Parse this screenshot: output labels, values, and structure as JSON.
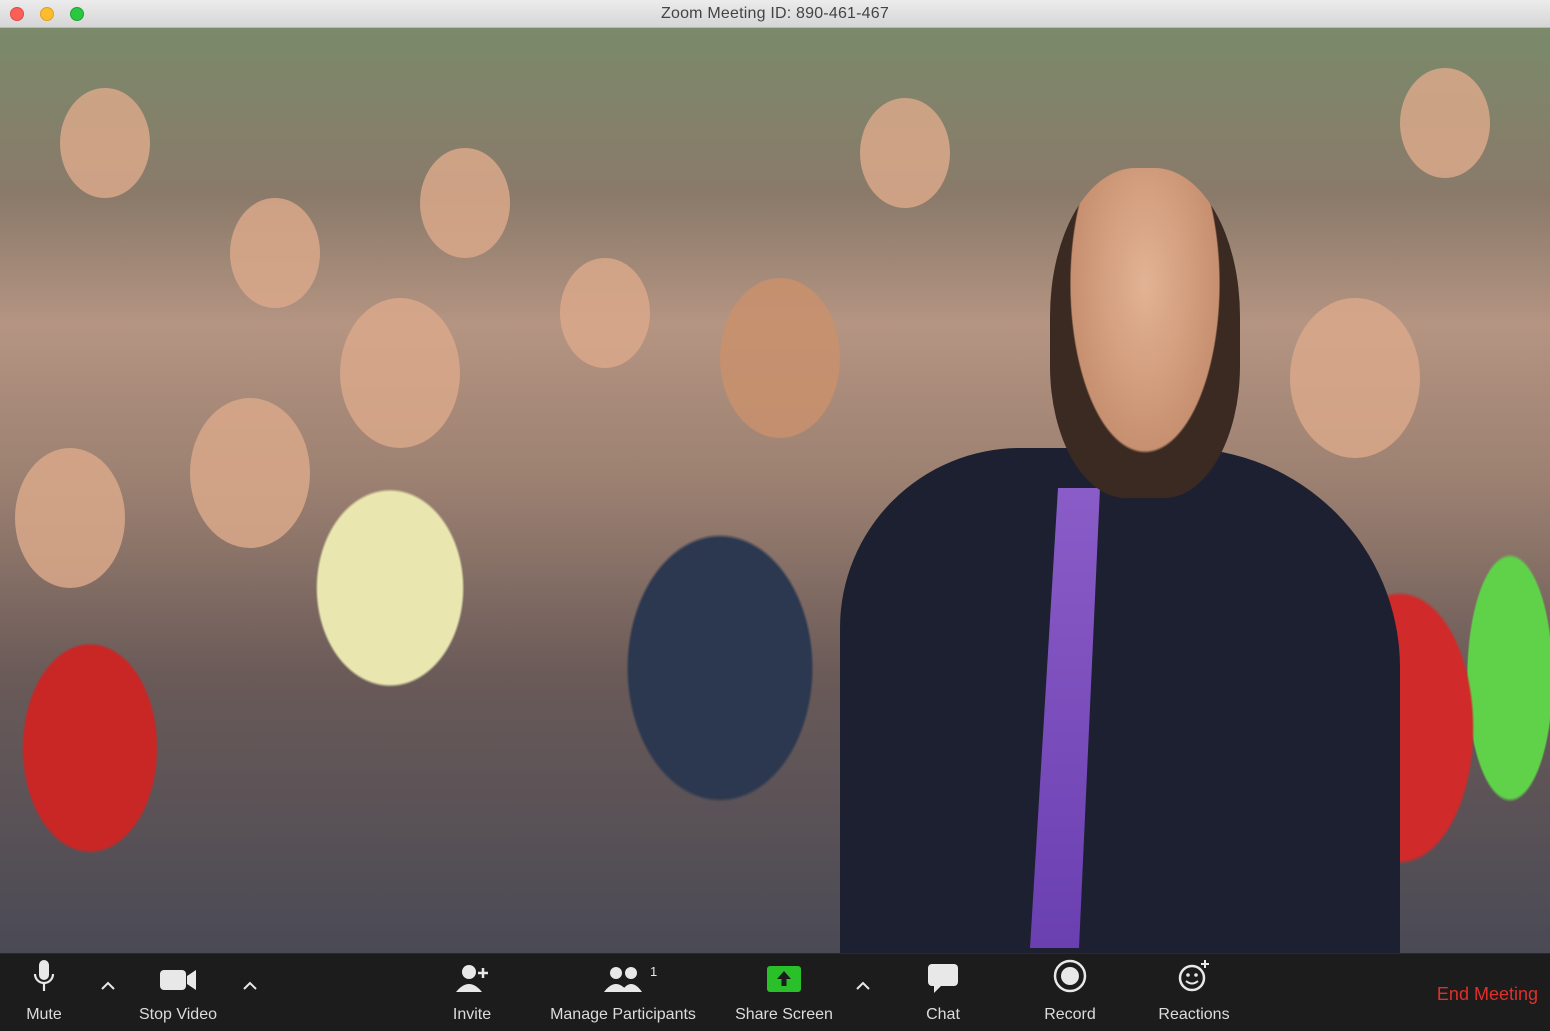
{
  "window": {
    "title": "Zoom Meeting ID: 890-461-467"
  },
  "video": {
    "description_icon": "video-feed"
  },
  "toolbar": {
    "mute_label": "Mute",
    "stop_video_label": "Stop Video",
    "invite_label": "Invite",
    "manage_participants_label": "Manage Participants",
    "participants_count": "1",
    "share_screen_label": "Share Screen",
    "chat_label": "Chat",
    "record_label": "Record",
    "reactions_label": "Reactions",
    "end_meeting_label": "End Meeting"
  },
  "colors": {
    "end_meeting": "#e0302a",
    "share_screen": "#2ac02a",
    "toolbar_bg": "#1c1c1c"
  }
}
